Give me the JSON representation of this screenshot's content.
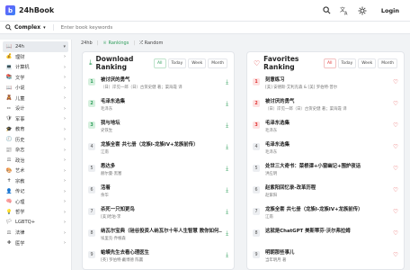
{
  "app": {
    "name": "24hBook",
    "logo_letter": "b"
  },
  "topbar": {
    "search_icon": "search-icon",
    "translate_icon": "translate-icon",
    "theme_icon": "sun-icon",
    "login_label": "Login"
  },
  "search": {
    "type_label": "Complex",
    "placeholder": "Enter book keywords"
  },
  "sidebar": {
    "items": [
      {
        "label": "24h",
        "icon": "📖",
        "active": true
      },
      {
        "label": "理财",
        "icon": "💰"
      },
      {
        "label": "计算机",
        "icon": "💻"
      },
      {
        "label": "文学",
        "icon": "📚"
      },
      {
        "label": "小说",
        "icon": "📖"
      },
      {
        "label": "儿童",
        "icon": "🧸"
      },
      {
        "label": "设计",
        "icon": "✏"
      },
      {
        "label": "军事",
        "icon": "🛡"
      },
      {
        "label": "教育",
        "icon": "🎓"
      },
      {
        "label": "历史",
        "icon": "🕘"
      },
      {
        "label": "杂志",
        "icon": "📰"
      },
      {
        "label": "政治",
        "icon": "⚖"
      },
      {
        "label": "艺术",
        "icon": "🎨"
      },
      {
        "label": "宗教",
        "icon": "✝"
      },
      {
        "label": "传记",
        "icon": "👤"
      },
      {
        "label": "心理",
        "icon": "🧠"
      },
      {
        "label": "哲学",
        "icon": "💡"
      },
      {
        "label": "LGBTQ+",
        "icon": "🏳"
      },
      {
        "label": "法律",
        "icon": "⚖"
      },
      {
        "label": "医学",
        "icon": "✚"
      }
    ]
  },
  "crumbs": {
    "home": "24hb",
    "rankings": "Rankings",
    "random": "Random"
  },
  "download": {
    "title": "Download Ranking",
    "tabs": [
      {
        "label": "All",
        "on": true
      },
      {
        "label": "Today"
      },
      {
        "label": "Week"
      },
      {
        "label": "Month"
      }
    ],
    "items": [
      {
        "rank": "1",
        "title": "被讨厌的勇气",
        "author": "（日）岸见一郎（日）古贺史健 著；渠海霞 译"
      },
      {
        "rank": "2",
        "title": "毛泽东选集",
        "author": "毛泽东"
      },
      {
        "rank": "3",
        "title": "我与地坛",
        "author": "史铁生"
      },
      {
        "rank": "4",
        "title": "龙族全套 共七册（龙族I-龙族IV+龙族前传）",
        "author": "江南"
      },
      {
        "rank": "5",
        "title": "悉达多",
        "author": "赫尔曼·黑塞"
      },
      {
        "rank": "6",
        "title": "活着",
        "author": "余华"
      },
      {
        "rank": "7",
        "title": "杀死一只知更鸟",
        "author": "[美]哈珀·李"
      },
      {
        "rank": "8",
        "title": "纳瓦尔宝典（硅谷投资人纳瓦尔十年人生智慧 教你如何…",
        "author": "埃里克·乔根森"
      },
      {
        "rank": "9",
        "title": "蛤蟆先生去看心理医生",
        "author": "[英] 罗伯特·戴博德 陈赢"
      }
    ]
  },
  "favorites": {
    "title": "Favorites Ranking",
    "tabs": [
      {
        "label": "All",
        "on": true
      },
      {
        "label": "Today"
      },
      {
        "label": "Week"
      },
      {
        "label": "Month"
      }
    ],
    "items": [
      {
        "rank": "1",
        "title": "刻意练习",
        "author": "[美] 安德斯·艾利克森 & [美] 罗伯特·普尔"
      },
      {
        "rank": "2",
        "title": "被讨厌的勇气",
        "author": "（日）岸见一郎（日）古贺史健 著；渠海霞 译"
      },
      {
        "rank": "3",
        "title": "毛泽东选集",
        "author": "毛泽东"
      },
      {
        "rank": "4",
        "title": "毛泽东选集",
        "author": "毛泽东"
      },
      {
        "rank": "5",
        "title": "处世三大奇书：菜根谭+小窗幽记+围炉夜话",
        "author": "洪应明"
      },
      {
        "rank": "6",
        "title": "赵紫阳回忆录-改革历程",
        "author": "赵紫阳"
      },
      {
        "rank": "7",
        "title": "龙族全套 共七册（龙族I-龙族IV+龙族前传）",
        "author": "江南"
      },
      {
        "rank": "8",
        "title": "这就是ChatGPT 美斯蒂芬·沃尔弗拉姆",
        "author": ""
      },
      {
        "rank": "9",
        "title": "明朝那些事儿",
        "author": "当年明月 著"
      }
    ]
  }
}
